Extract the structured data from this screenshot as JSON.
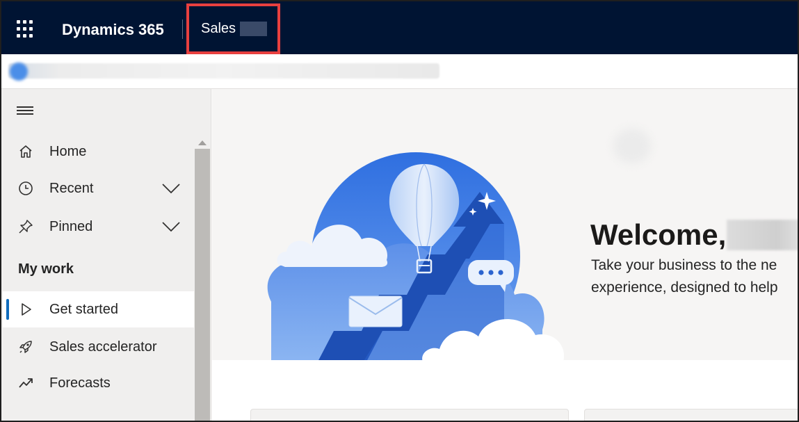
{
  "topbar": {
    "brand": "Dynamics 365",
    "module": "Sales",
    "module_highlight_color": "#e8403f",
    "background_color": "#001433"
  },
  "sidebar": {
    "items": [
      {
        "label": "Home",
        "icon": "home-icon"
      },
      {
        "label": "Recent",
        "icon": "clock-icon",
        "expandable": true
      },
      {
        "label": "Pinned",
        "icon": "pin-icon",
        "expandable": true
      }
    ],
    "section": "My work",
    "work_items": [
      {
        "label": "Get started",
        "icon": "play-icon",
        "selected": true
      },
      {
        "label": "Sales accelerator",
        "icon": "rocket-icon"
      },
      {
        "label": "Forecasts",
        "icon": "trend-icon"
      }
    ],
    "selected_color": "#0f6cbd"
  },
  "main": {
    "welcome": "Welcome,",
    "tagline_line1": "Take your business to the ne",
    "tagline_line2": "experience, designed to help"
  }
}
